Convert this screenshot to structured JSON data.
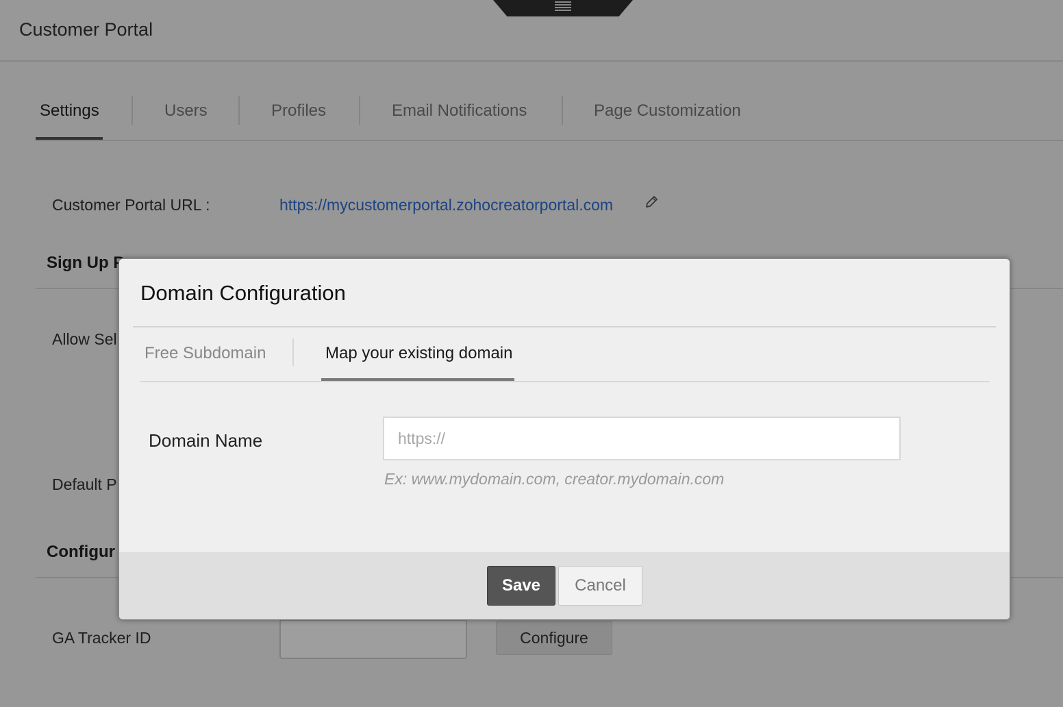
{
  "header": {
    "title": "Customer Portal"
  },
  "tabs": [
    {
      "label": "Settings",
      "active": true
    },
    {
      "label": "Users",
      "active": false
    },
    {
      "label": "Profiles",
      "active": false
    },
    {
      "label": "Email Notifications",
      "active": false
    },
    {
      "label": "Page Customization",
      "active": false
    }
  ],
  "portal_url": {
    "label": "Customer Portal URL :",
    "value": "https://mycustomerportal.zohocreatorportal.com"
  },
  "sections": {
    "signup": "Sign Up P",
    "configure": "Configur"
  },
  "fields": {
    "allow": "Allow Sel",
    "default": "Default P",
    "ga_tracker": "GA Tracker ID",
    "ga_value": "",
    "configure_button": "Configure"
  },
  "modal": {
    "title": "Domain Configuration",
    "tabs": [
      {
        "label": "Free Subdomain",
        "active": false
      },
      {
        "label": "Map your existing domain",
        "active": true
      }
    ],
    "domain_label": "Domain Name",
    "domain_placeholder": "https://",
    "domain_value": "",
    "hint": "Ex: www.mydomain.com, creator.mydomain.com",
    "save_label": "Save",
    "cancel_label": "Cancel"
  },
  "colors": {
    "link": "#2d6fd4",
    "save_button": "#555555",
    "overlay": "rgba(0,0,0,0.38)"
  },
  "icons": {
    "menu": "hamburger-icon",
    "edit": "pencil-icon"
  }
}
